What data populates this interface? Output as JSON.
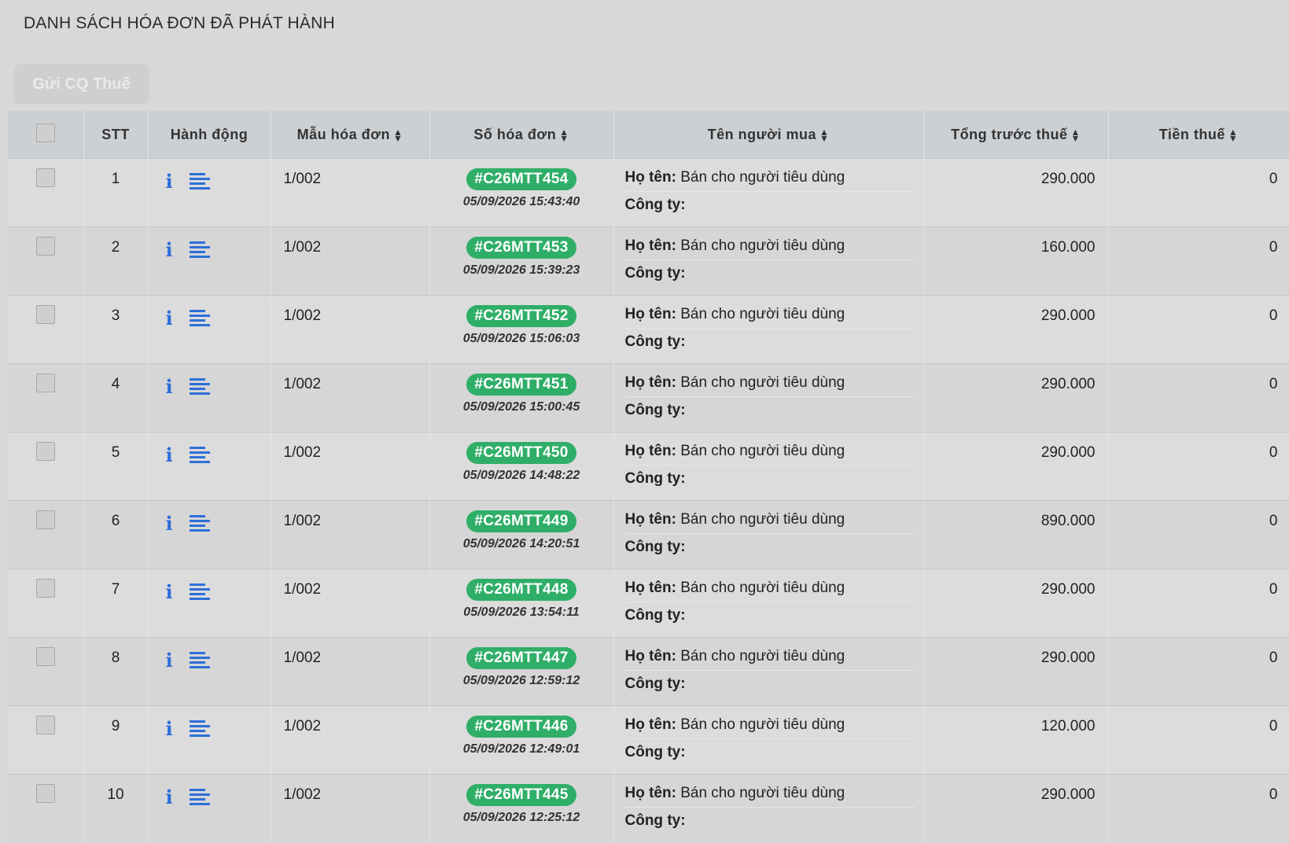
{
  "page": {
    "title": "DANH SÁCH HÓA ĐƠN ĐÃ PHÁT HÀNH",
    "send_button": "Gửi CQ Thuế"
  },
  "table": {
    "headers": {
      "stt": "STT",
      "actions": "Hành động",
      "template": "Mẫu hóa đơn",
      "invoice_no": "Số hóa đơn",
      "buyer": "Tên người mua",
      "pre_tax": "Tổng trước thuế",
      "tax": "Tiền thuế"
    },
    "buyer_name_label": "Họ tên:",
    "buyer_company_label": "Công ty:",
    "rows": [
      {
        "stt": "1",
        "template": "1/002",
        "invoice": "#C26MTT454",
        "date": "05/09/2026 15:43:40",
        "name": "Bán cho người tiêu dùng",
        "company": "",
        "pre_tax": "290.000",
        "tax": "0"
      },
      {
        "stt": "2",
        "template": "1/002",
        "invoice": "#C26MTT453",
        "date": "05/09/2026 15:39:23",
        "name": "Bán cho người tiêu dùng",
        "company": "",
        "pre_tax": "160.000",
        "tax": "0"
      },
      {
        "stt": "3",
        "template": "1/002",
        "invoice": "#C26MTT452",
        "date": "05/09/2026 15:06:03",
        "name": "Bán cho người tiêu dùng",
        "company": "",
        "pre_tax": "290.000",
        "tax": "0"
      },
      {
        "stt": "4",
        "template": "1/002",
        "invoice": "#C26MTT451",
        "date": "05/09/2026 15:00:45",
        "name": "Bán cho người tiêu dùng",
        "company": "",
        "pre_tax": "290.000",
        "tax": "0"
      },
      {
        "stt": "5",
        "template": "1/002",
        "invoice": "#C26MTT450",
        "date": "05/09/2026 14:48:22",
        "name": "Bán cho người tiêu dùng",
        "company": "",
        "pre_tax": "290.000",
        "tax": "0"
      },
      {
        "stt": "6",
        "template": "1/002",
        "invoice": "#C26MTT449",
        "date": "05/09/2026 14:20:51",
        "name": "Bán cho người tiêu dùng",
        "company": "",
        "pre_tax": "890.000",
        "tax": "0"
      },
      {
        "stt": "7",
        "template": "1/002",
        "invoice": "#C26MTT448",
        "date": "05/09/2026 13:54:11",
        "name": "Bán cho người tiêu dùng",
        "company": "",
        "pre_tax": "290.000",
        "tax": "0"
      },
      {
        "stt": "8",
        "template": "1/002",
        "invoice": "#C26MTT447",
        "date": "05/09/2026 12:59:12",
        "name": "Bán cho người tiêu dùng",
        "company": "",
        "pre_tax": "290.000",
        "tax": "0"
      },
      {
        "stt": "9",
        "template": "1/002",
        "invoice": "#C26MTT446",
        "date": "05/09/2026 12:49:01",
        "name": "Bán cho người tiêu dùng",
        "company": "",
        "pre_tax": "120.000",
        "tax": "0"
      },
      {
        "stt": "10",
        "template": "1/002",
        "invoice": "#C26MTT445",
        "date": "05/09/2026 12:25:12",
        "name": "Bán cho người tiêu dùng",
        "company": "",
        "pre_tax": "290.000",
        "tax": "0"
      }
    ]
  },
  "icons": {
    "info": "info-icon",
    "detail": "list-icon",
    "sort": "sort-icon"
  },
  "colors": {
    "badge": "#2fae68",
    "icon": "#2e6fd8"
  }
}
